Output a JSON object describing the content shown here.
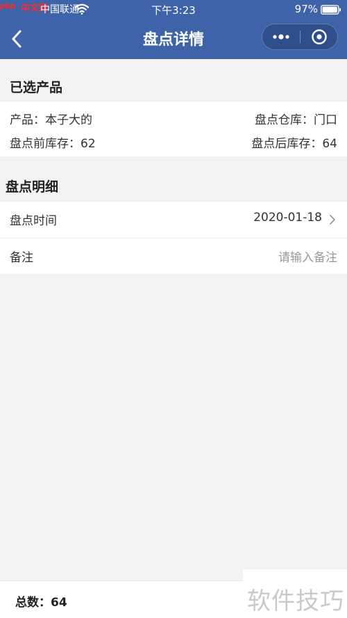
{
  "status_bar": {
    "logo_left": "php",
    "logo_right": "中文网",
    "carrier": "中国联通",
    "time": "下午3:23",
    "battery": "97%"
  },
  "nav": {
    "title": "盘点详情"
  },
  "selected_product": {
    "section_title": "已选产品",
    "product": "产品：本子大的",
    "warehouse": "盘点仓库：门口",
    "stock_before": "盘点前库存：62",
    "stock_after": "盘点后库存：64"
  },
  "details": {
    "section_title": "盘点明细",
    "time_label": "盘点时间",
    "time_value": "2020-01-18",
    "remark_label": "备注",
    "remark_placeholder": "请输入备注"
  },
  "footer": {
    "total": "总数：64"
  },
  "watermark": {
    "text": "软件技巧"
  },
  "colors": {
    "nav_background": "#3e63a8",
    "page_background": "#f2f2f2",
    "card_background": "#ffffff"
  }
}
